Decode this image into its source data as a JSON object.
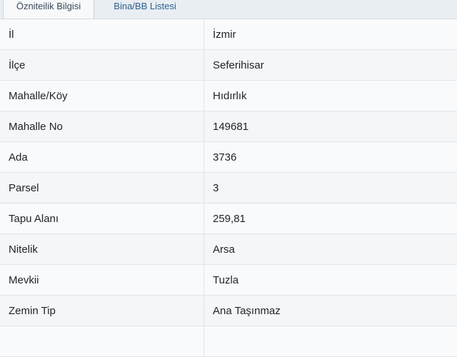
{
  "tabs": [
    {
      "label": "Özniteilik Bilgisi",
      "active": true
    },
    {
      "label": "Bina/BB Listesi",
      "active": false
    }
  ],
  "rows": [
    {
      "label": "İl",
      "value": "İzmir"
    },
    {
      "label": "İlçe",
      "value": "Seferihisar"
    },
    {
      "label": "Mahalle/Köy",
      "value": "Hıdırlık"
    },
    {
      "label": "Mahalle No",
      "value": "149681"
    },
    {
      "label": "Ada",
      "value": "3736"
    },
    {
      "label": "Parsel",
      "value": "3"
    },
    {
      "label": "Tapu Alanı",
      "value": "259,81"
    },
    {
      "label": "Nitelik",
      "value": "Arsa"
    },
    {
      "label": "Mevkii",
      "value": "Tuzla"
    },
    {
      "label": "Zemin Tip",
      "value": "Ana Taşınmaz"
    },
    {
      "label": "",
      "value": ""
    }
  ],
  "colors": {
    "background": "#e9eef3",
    "tab_text": "#2f5f8a",
    "row_border": "#dfe4e9",
    "text": "#1e2328"
  }
}
